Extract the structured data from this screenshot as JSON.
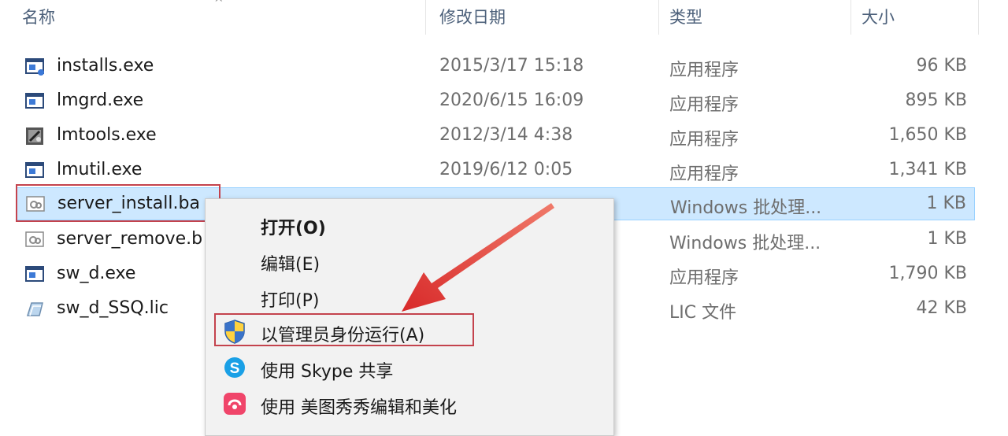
{
  "columns": {
    "name": "名称",
    "date": "修改日期",
    "type": "类型",
    "size": "大小"
  },
  "files": [
    {
      "name": "installs.exe",
      "date": "2015/3/17 15:18",
      "type": "应用程序",
      "size": "96 KB",
      "icon": "exe-installer-icon"
    },
    {
      "name": "lmgrd.exe",
      "date": "2020/6/15 16:09",
      "type": "应用程序",
      "size": "895 KB",
      "icon": "exe-window-icon"
    },
    {
      "name": "lmtools.exe",
      "date": "2012/3/14 4:38",
      "type": "应用程序",
      "size": "1,650 KB",
      "icon": "lmtools-icon"
    },
    {
      "name": "lmutil.exe",
      "date": "2019/6/12 0:05",
      "type": "应用程序",
      "size": "1,341 KB",
      "icon": "exe-window-icon"
    },
    {
      "name": "server_install.ba",
      "date": "",
      "type": "Windows 批处理...",
      "size": "1 KB",
      "icon": "batch-file-icon"
    },
    {
      "name": "server_remove.b",
      "date": "",
      "type": "Windows 批处理...",
      "size": "1 KB",
      "icon": "batch-file-icon"
    },
    {
      "name": "sw_d.exe",
      "date": "",
      "type": "应用程序",
      "size": "1,790 KB",
      "icon": "exe-window-icon"
    },
    {
      "name": "sw_d_SSQ.lic",
      "date": "",
      "type": "LIC 文件",
      "size": "42 KB",
      "icon": "lic-file-icon"
    }
  ],
  "context_menu": {
    "items": [
      {
        "label": "打开(O)",
        "bold": true,
        "icon": ""
      },
      {
        "label": "编辑(E)",
        "bold": false,
        "icon": ""
      },
      {
        "label": "打印(P)",
        "bold": false,
        "icon": ""
      },
      {
        "label": "以管理员身份运行(A)",
        "bold": false,
        "icon": "uac-shield-icon"
      },
      {
        "label": "使用 Skype 共享",
        "bold": false,
        "icon": "skype-icon"
      },
      {
        "label": "使用 美图秀秀编辑和美化",
        "bold": false,
        "icon": "meitu-icon"
      }
    ]
  },
  "colors": {
    "selection": "#cde8ff",
    "annotation": "#c4434d",
    "arrow": "#e8413c"
  }
}
